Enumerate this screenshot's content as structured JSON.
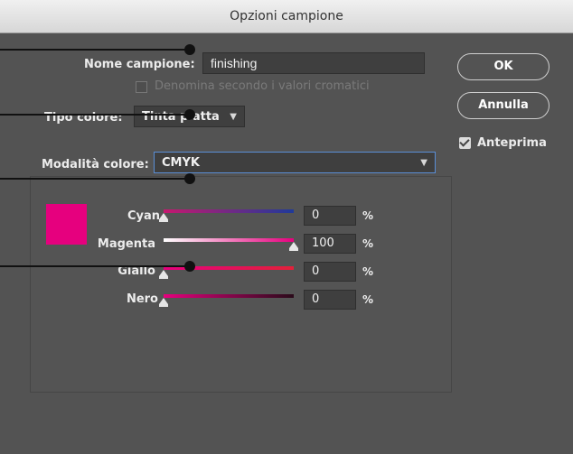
{
  "window": {
    "title": "Opzioni campione"
  },
  "name_field": {
    "label": "Nome campione:",
    "value": "finishing"
  },
  "auto_name": {
    "label": "Denomina secondo i valori cromatici",
    "checked": false,
    "enabled": false
  },
  "color_type": {
    "label": "Tipo colore:",
    "value": "Tinta piatta"
  },
  "color_mode": {
    "label": "Modalità colore:",
    "value": "CMYK"
  },
  "buttons": {
    "ok": "OK",
    "cancel": "Annulla"
  },
  "preview": {
    "label": "Anteprima",
    "checked": true
  },
  "swatch_color": "#e6007e",
  "channels": [
    {
      "label": "Cyan",
      "value": "0",
      "unit": "%",
      "level": 0
    },
    {
      "label": "Magenta",
      "value": "100",
      "unit": "%",
      "level": 100
    },
    {
      "label": "Giallo",
      "value": "0",
      "unit": "%",
      "level": 0
    },
    {
      "label": "Nero",
      "value": "0",
      "unit": "%",
      "level": 0
    }
  ],
  "icons": {
    "dropdown": "chevron-down-icon",
    "slider_thumb": "triangle-up-icon",
    "check": "checkmark-icon"
  }
}
